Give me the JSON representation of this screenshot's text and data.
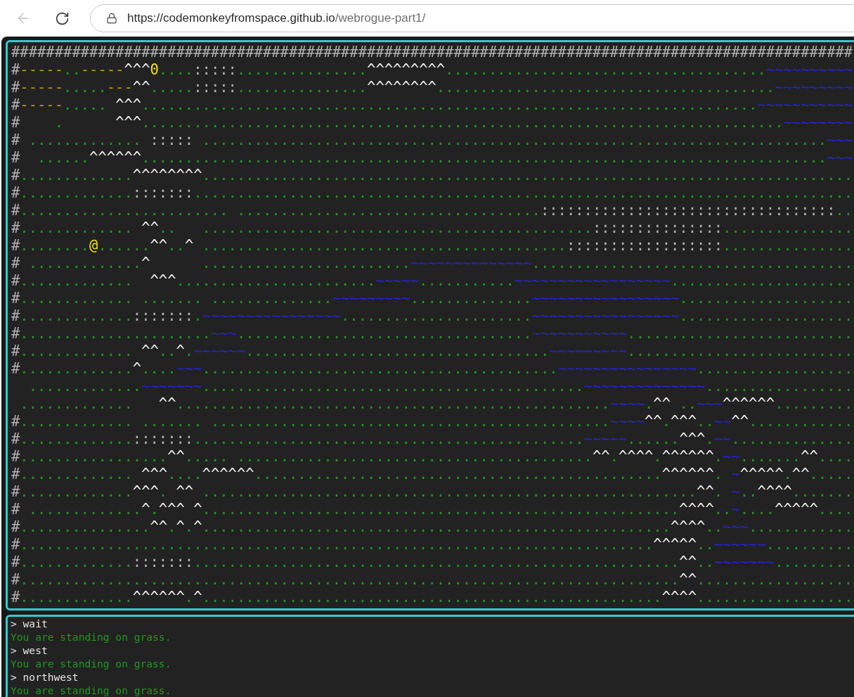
{
  "browser": {
    "back_button": {
      "disabled": true
    },
    "address": {
      "origin": "https://codemonkeyfromspace.github.io",
      "path": "/webrogue-part1/"
    }
  },
  "map": {
    "rows": [
      "#################################################################################################",
      "#-----..-----^^^0....:::::...............^^^^^^^^^.....................................~~~~~~~~~~",
      "#-----.....---^^.....:::::...............^^^^^^^^.......................................~~~~~~~~~",
      "#-----..... ^^^.......................................................................~~~~~~~~~~~",
      "#    .      ^^^..........................................................................~~~~~~~~",
      "# ............. ::::: ........................................................................~~~",
      "#  ......^^^^^^...............................................................................~~~",
      "#.............^^^^^^^^...........................................................................",
      "#.............:::::::............................................................................",
      "#........................ ...................................::::::::::::::::::::::::::::::::::..",
      "#............. ^^..   .............................................:::::::::::::::...............",
      "#........@......^^..^ ..........................................::::::::::::::::::...............",
      "# .............^      ........................~~~~~~~~~~~~~~.....................................",
      "#.............  ^^^.......................~~~~~...........~~~~~~~~~~~~~~~~~~.....................",
      "#............. ....... ..............~~~~~~~~~..............~~~~~~~~~~~~~~~~~....................",
      "#.............:::::::.~~~~~~~~~~~~~~~~......................~~~~~~~~~~~~~~~~~....................",
      "#......................~~~..................................~~~~~~~~~~~..........................",
      "#............. ^^..^.~~~~~~...................................~~~~~~~~~..........................",
      "#.............^....~~~.........................................~~~~~~~~~~~~~~~~..................",
      "  .............~~~~~~~............................................~~~~~~~~~~~~~~.................",
      " .............   ^^..................................................~~~~.^^ ..~~~^^^^^^.........",
      "#............. ....... ..............................................~~~~^^.^^^..~~^^............",
      "#.............:::::::.............................................~~~~~......^^^.~~..............",
      "#.................^^..... .........................................^^.^^^^.^^^^^^.~~.......^^....",
      "#............. ^^^....^^^^^^...............................................^^^^^^. ~^^^^^.^^.....",
      "#.............^^^. ^^ .........................................................^^. ~..^^^^.......",
      "# .............^.^^^ ^.......................................................^^^^..~....^^^^^....",
      "#...............^^.^.^......................................................^^^^..~~~............",
      "#.........................................................................^^^^^..~~~~~~..........",
      "#.............:::::::........................................................^^..~~~~~~~.........",
      "#............................................................................^^..................",
      "#.............^^^^^^.^.....................................................^^^^.................."
    ]
  },
  "log": [
    {
      "kind": "command",
      "text": "> wait"
    },
    {
      "kind": "message",
      "text": "You are standing on grass."
    },
    {
      "kind": "command",
      "text": "> west"
    },
    {
      "kind": "message",
      "text": "You are standing on grass."
    },
    {
      "kind": "command",
      "text": "> northwest"
    },
    {
      "kind": "message",
      "text": "You are standing on grass."
    }
  ]
}
